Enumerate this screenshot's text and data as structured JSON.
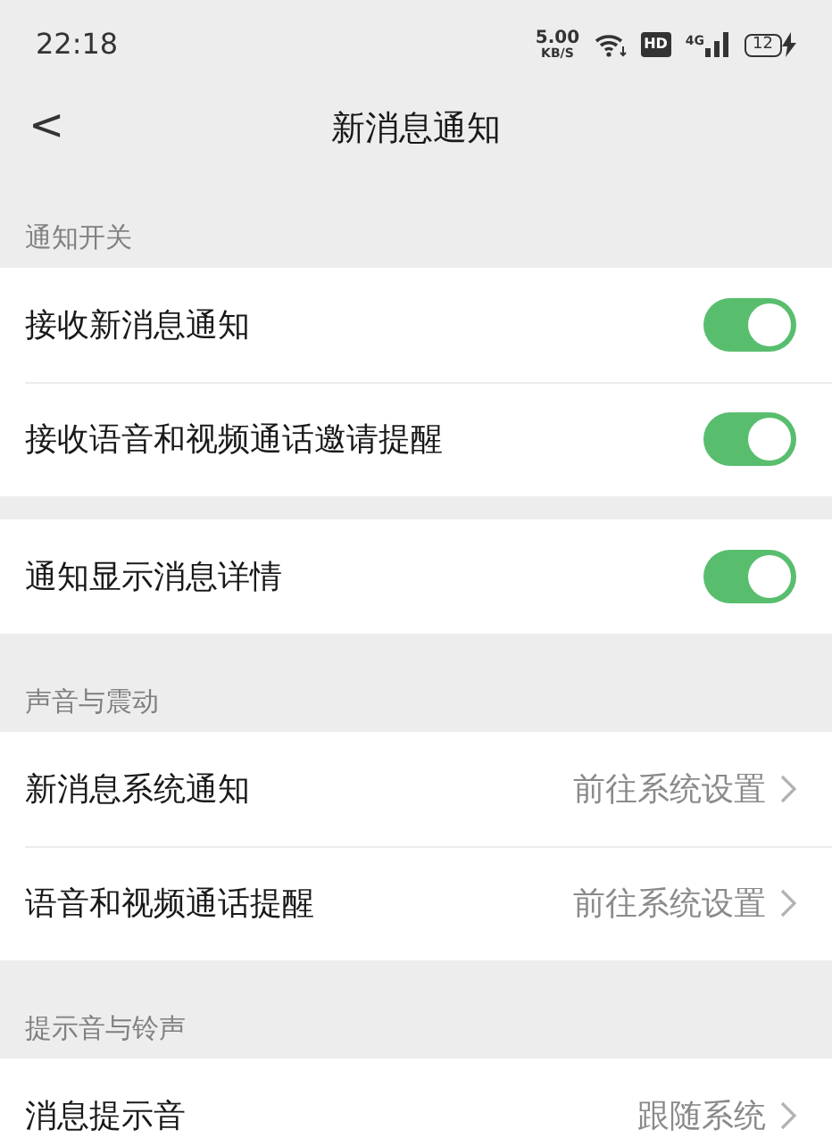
{
  "status_bar": {
    "time": "22:18",
    "speed": "5.00",
    "speed_unit": "KB/S",
    "hd": "HD",
    "network": "4G",
    "battery": "12"
  },
  "header": {
    "back": "<",
    "title": "新消息通知"
  },
  "sections": [
    {
      "title": "通知开关",
      "groups": [
        [
          {
            "kind": "toggle",
            "label": "接收新消息通知",
            "on": true
          },
          {
            "kind": "toggle",
            "label": "接收语音和视频通话邀请提醒",
            "on": true
          }
        ],
        [
          {
            "kind": "toggle",
            "label": "通知显示消息详情",
            "on": true
          }
        ]
      ]
    },
    {
      "title": "声音与震动",
      "groups": [
        [
          {
            "kind": "link",
            "label": "新消息系统通知",
            "value": "前往系统设置"
          },
          {
            "kind": "link",
            "label": "语音和视频通话提醒",
            "value": "前往系统设置"
          }
        ]
      ]
    },
    {
      "title": "提示音与铃声",
      "groups": [
        [
          {
            "kind": "link",
            "label": "消息提示音",
            "value": "跟随系统"
          }
        ]
      ]
    }
  ]
}
